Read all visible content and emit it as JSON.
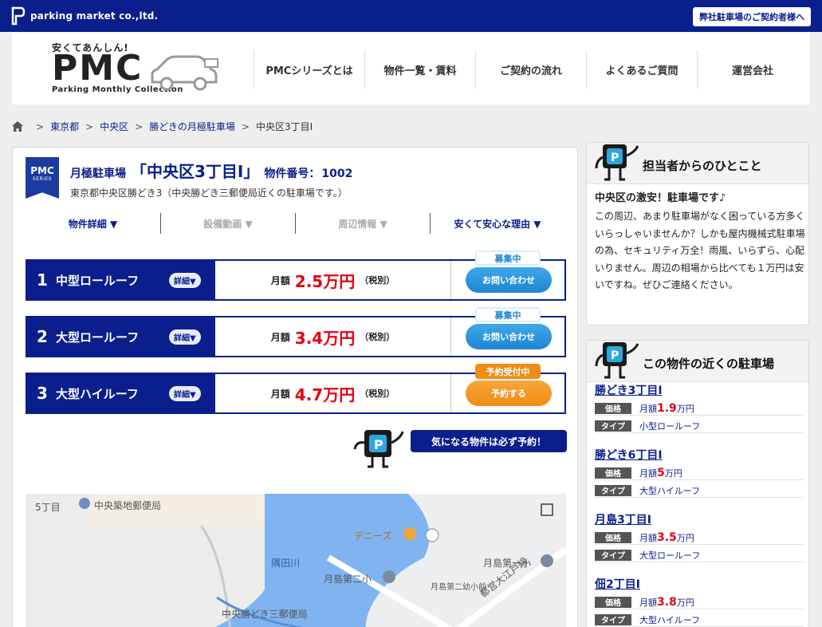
{
  "topbar": {
    "company": "parking market co.,ltd.",
    "owner_link": "弊社駐車場のご契約者様へ"
  },
  "header": {
    "logo_tagline": "安くてあんしん!",
    "logo_name": "PMC",
    "logo_sub": "Parking Monthly Collection",
    "nav": [
      "PMCシリーズとは",
      "物件一覧・賃料",
      "ご契約の流れ",
      "よくあるご質問",
      "運営会社"
    ]
  },
  "breadcrumb": {
    "items": [
      "東京都",
      "中央区",
      "勝どきの月極駐車場"
    ],
    "current": "中央区3丁目I"
  },
  "property": {
    "badge_line1": "PMC",
    "badge_line2": "SERIES",
    "kind": "月極駐車場",
    "name": "「中央区3丁目I」",
    "number_label": "物件番号：",
    "number": "1002",
    "address": "東京都中央区勝どき3（中央勝どき三郵便局近くの駐車場です。）",
    "tabs": [
      "物件詳細 ▼",
      "設備動画 ▼",
      "周辺情報 ▼",
      "安くて安心な理由 ▼"
    ],
    "spaces": [
      {
        "num": "1",
        "type": "中型ロールーフ",
        "detail": "詳細▼",
        "monthly": "月額",
        "price": "2.5万円",
        "tax": "（税別）",
        "tag": "募集中",
        "button": "お問い合わせ"
      },
      {
        "num": "2",
        "type": "大型ロールーフ",
        "detail": "詳細▼",
        "monthly": "月額",
        "price": "3.4万円",
        "tax": "（税別）",
        "tag": "募集中",
        "button": "お問い合わせ"
      },
      {
        "num": "3",
        "type": "大型ハイルーフ",
        "detail": "詳細▼",
        "monthly": "月額",
        "price": "4.7万円",
        "tax": "（税別）",
        "tag": "予約受付中",
        "button": "予約する"
      }
    ],
    "reserve_message": "気になる物件は必ず予約！"
  },
  "map": {
    "labels": [
      "5丁目",
      "中央築地郵便局",
      "デニーズ",
      "隅田川",
      "月島第二小",
      "月島第一小",
      "月島第二幼小前",
      "都営大江戸線",
      "中央勝どき三郵便局"
    ]
  },
  "staff_box": {
    "title": "担当者からのひとこと",
    "message_title": "中央区の激安！駐車場です♪",
    "message": "この周辺、あまり駐車場がなく困っている方多くいらっしゃいませんか？しかも屋内機械式駐車場の為、セキュリティ万全！雨風、いらずら、心配いりません。周辺の相場から比べても１万円は安いですね。ぜひご連絡ください。"
  },
  "nearby_box": {
    "title": "この物件の近くの駐車場",
    "price_label": "価格",
    "type_label": "タイプ",
    "monthly_prefix": "月額",
    "unit": "万円",
    "items": [
      {
        "name": "勝どき3丁目I",
        "price": "1.9",
        "type": "小型ロールーフ"
      },
      {
        "name": "勝どき6丁目I",
        "price": "5",
        "type": "大型ハイルーフ"
      },
      {
        "name": "月島3丁目I",
        "price": "3.5",
        "type": "大型ロールーフ"
      },
      {
        "name": "佃2丁目I",
        "price": "3.8",
        "type": "大型ハイルーフ"
      }
    ]
  },
  "colors": {
    "navy": "#0a1e8c",
    "price_red": "#e60012",
    "cta_blue": "#1d86d2",
    "cta_orange": "#ef8c15"
  }
}
